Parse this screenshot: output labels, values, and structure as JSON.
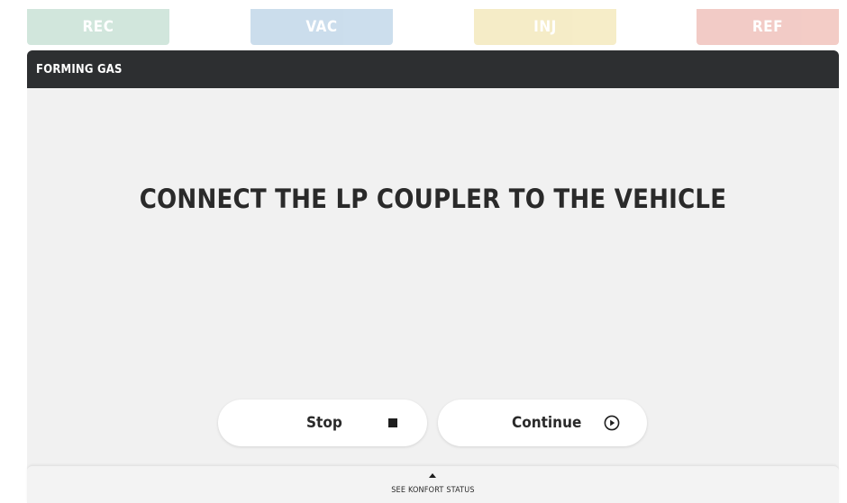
{
  "tabs": [
    {
      "label": "REC",
      "color": "#cfe5db"
    },
    {
      "label": "VAC",
      "color": "#c9dcec"
    },
    {
      "label": "INJ",
      "color": "#f5ecc5"
    },
    {
      "label": "REF",
      "color": "#f2c9c3"
    }
  ],
  "panel": {
    "title": "FORMING GAS",
    "instruction": "CONNECT THE LP COUPLER TO THE VEHICLE"
  },
  "actions": {
    "stop": {
      "label": "Stop",
      "icon": "stop-icon"
    },
    "continue": {
      "label": "Continue",
      "icon": "play-circle-icon"
    }
  },
  "status_bar": {
    "label": "SEE KONFORT STATUS",
    "icon": "caret-up-icon"
  },
  "colors": {
    "header_bg": "#2d2f31",
    "panel_bg": "#f1f1f1",
    "text": "#2a2a2a"
  }
}
